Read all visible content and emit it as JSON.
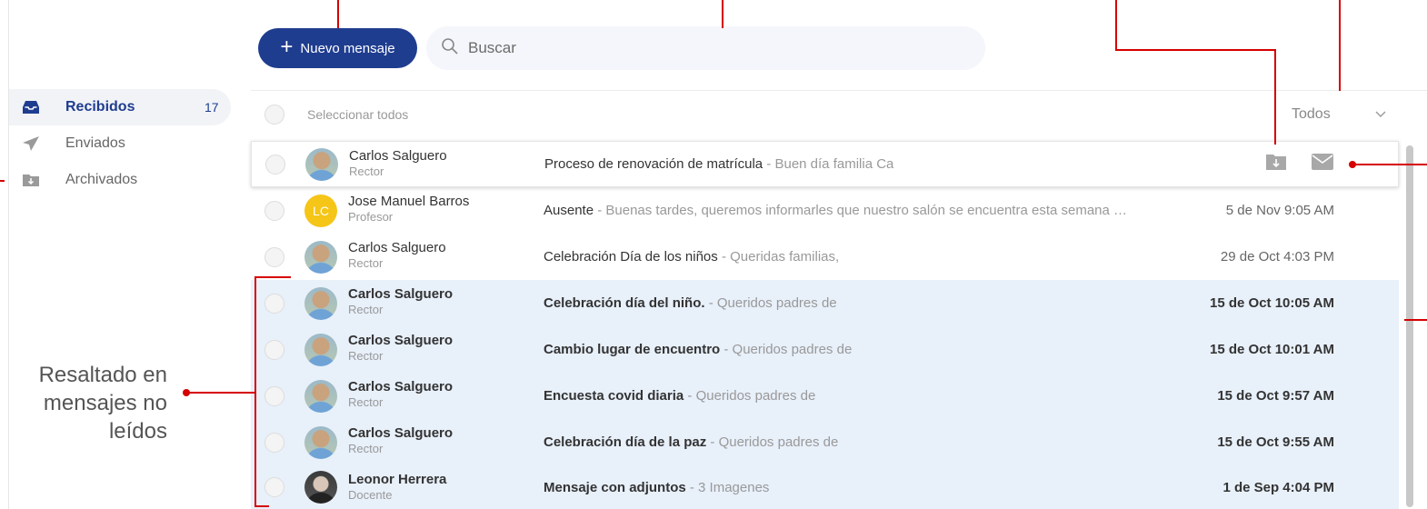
{
  "toolbar": {
    "new_message_label": "Nuevo mensaje",
    "search_placeholder": "Buscar"
  },
  "sidebar": {
    "items": [
      {
        "label": "Recibidos",
        "count": "17",
        "icon": "inbox-icon",
        "active": true
      },
      {
        "label": "Enviados",
        "count": "",
        "icon": "send-icon",
        "active": false
      },
      {
        "label": "Archivados",
        "count": "",
        "icon": "archive-icon",
        "active": false
      }
    ]
  },
  "list": {
    "select_all_label": "Seleccionar todos",
    "filter_value": "Todos"
  },
  "messages": [
    {
      "name": "Carlos Salguero",
      "role": "Rector",
      "subject": "Proceso de renovación de matrícula",
      "preview": " - Buen día familia Ca",
      "date": "",
      "unread": false,
      "avatar": "photo"
    },
    {
      "name": "Jose Manuel Barros",
      "role": "Profesor",
      "subject": "Ausente",
      "preview": " - Buenas tardes, queremos informarles que nuestro salón se encuentra esta semana …",
      "date": "5 de Nov 9:05 AM",
      "unread": false,
      "avatar": "LC"
    },
    {
      "name": "Carlos Salguero",
      "role": "Rector",
      "subject": "Celebración Día de los niños",
      "preview": " - Queridas familias,",
      "date": "29 de Oct 4:03 PM",
      "unread": false,
      "avatar": "photo"
    },
    {
      "name": "Carlos Salguero",
      "role": "Rector",
      "subject": "Celebración día del niño.",
      "preview": " - Queridos padres de",
      "date": "15 de Oct 10:05 AM",
      "unread": true,
      "avatar": "photo"
    },
    {
      "name": "Carlos Salguero",
      "role": "Rector",
      "subject": "Cambio lugar de encuentro",
      "preview": " - Queridos padres de",
      "date": "15 de Oct 10:01 AM",
      "unread": true,
      "avatar": "photo"
    },
    {
      "name": "Carlos Salguero",
      "role": "Rector",
      "subject": "Encuesta covid diaria",
      "preview": " - Queridos padres de",
      "date": "15 de Oct 9:57 AM",
      "unread": true,
      "avatar": "photo"
    },
    {
      "name": "Carlos Salguero",
      "role": "Rector",
      "subject": "Celebración día de la paz",
      "preview": " - Queridos padres de",
      "date": "15 de Oct 9:55 AM",
      "unread": true,
      "avatar": "photo"
    },
    {
      "name": "Leonor Herrera",
      "role": "Docente",
      "subject": "Mensaje con adjuntos",
      "preview": " - 3 Imagenes",
      "date": "1 de Sep 4:04 PM",
      "unread": true,
      "avatar": "dark"
    }
  ],
  "annotation": {
    "line1": "Resaltado en",
    "line2": "mensajes no",
    "line3": "leídos"
  },
  "colors": {
    "accent": "#1f3d8f",
    "unread_bg": "#e8f0fa",
    "annotation": "#d60000"
  }
}
